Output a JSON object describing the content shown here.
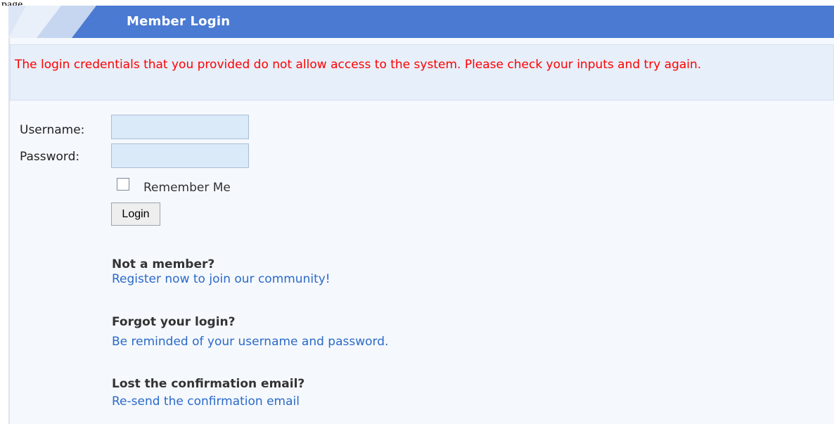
{
  "page": {
    "edge_label": "page"
  },
  "header": {
    "title": "Member Login"
  },
  "error": {
    "message": "The login credentials that you provided do not allow access to the system. Please check your inputs and try again."
  },
  "form": {
    "username_label": "Username:",
    "username_value": "",
    "password_label": "Password:",
    "password_value": "",
    "remember_label": "Remember Me",
    "remember_checked": false,
    "login_label": "Login"
  },
  "sections": {
    "not_member_title": "Not a member?",
    "register_link": "Register now to join our community!",
    "forgot_title": "Forgot your login?",
    "remind_link": "Be reminded of your username and password.",
    "lost_email_title": "Lost the confirmation email?",
    "resend_link": "Re-send the confirmation email"
  },
  "colors": {
    "header_blue": "#4a7ad2",
    "error_red": "#ff0000",
    "link_blue": "#2a6ac8"
  }
}
